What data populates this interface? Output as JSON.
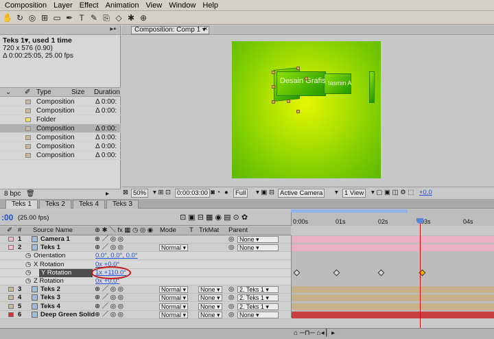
{
  "menubar": [
    "Composition",
    "Layer",
    "Effect",
    "Animation",
    "View",
    "Window",
    "Help"
  ],
  "toolbar": {
    "icons": [
      "hand-tool-icon",
      "rotate-tool-icon",
      "orbit-camera-icon",
      "track-xy-icon",
      "rectangle-mask-icon",
      "pen-tool-icon",
      "type-tool-icon",
      "brush-tool-icon",
      "clone-stamp-icon",
      "eraser-icon",
      "puppet-pin-icon",
      "axis-mode-icon"
    ],
    "glyphs": [
      "✋",
      "↻",
      "◎",
      "⊞",
      "▭",
      "✒",
      "T",
      "✎",
      "⎘",
      "◇",
      "✱",
      "⊕"
    ]
  },
  "project": {
    "item_name": "Teks 1▾, used 1 time",
    "size": "720 x 576 (0.90)",
    "duration": "Δ 0:00:25:05, 25.00 fps",
    "columns": {
      "type": "Type",
      "size": "Size",
      "duration": "Duration"
    },
    "rows": [
      {
        "type": "Composition",
        "duration": "Δ 0:00:",
        "swatch": "#c8b89a",
        "selected": false
      },
      {
        "type": "Composition",
        "duration": "Δ 0:00:",
        "swatch": "#c8b89a",
        "selected": false
      },
      {
        "type": "Folder",
        "duration": "",
        "swatch": "#f0e060",
        "selected": false
      },
      {
        "type": "Composition",
        "duration": "Δ 0:00:",
        "swatch": "#c8b89a",
        "selected": true
      },
      {
        "type": "Composition",
        "duration": "Δ 0:00:",
        "swatch": "#c8b89a",
        "selected": false
      },
      {
        "type": "Composition",
        "duration": "Δ 0:00:",
        "swatch": "#c8b89a",
        "selected": false
      },
      {
        "type": "Composition",
        "duration": "Δ 0:00:",
        "swatch": "#c8b89a",
        "selected": false
      }
    ],
    "bpc": "8 bpc"
  },
  "composition": {
    "tab_label": "Composition: Comp 1",
    "close": "×",
    "text_main": "Desain Grafis",
    "text_mirror": "Iasmin A",
    "zoom": "50%",
    "timecode": "0:00:03:00",
    "resolution": "Full",
    "camera": "Active Camera",
    "views": "1 View",
    "exposure": "+0.0"
  },
  "timeline": {
    "tabs": [
      "Teks 1",
      "Teks 2",
      "Teks 4",
      "Teks 3"
    ],
    "active_tab": 0,
    "current_time": ":00",
    "fps": "(25.00 fps)",
    "ruler_ticks": [
      "0:00s",
      "01s",
      "02s",
      "03s",
      "04s"
    ],
    "columns": {
      "num": "#",
      "source": "Source Name",
      "mode": "Mode",
      "t": "T",
      "trkmat": "TrkMat",
      "parent": "Parent"
    },
    "layers": [
      {
        "num": "1",
        "name": "Camera 1",
        "color": "#f2b8c8",
        "mode": "",
        "trkmat": "",
        "parent": "None"
      },
      {
        "num": "2",
        "name": "Teks 1",
        "color": "#f2b8c8",
        "mode": "Normal",
        "trkmat": "",
        "parent": "None"
      }
    ],
    "properties": [
      {
        "name": "Orientation",
        "value": "0.0°, 0.0°, 0.0°"
      },
      {
        "name": "X Rotation",
        "value": "0x +0.0°"
      },
      {
        "name": "Y Rotation",
        "value": "1x +110.0°"
      },
      {
        "name": "Z Rotation",
        "value": "0x +0.0°"
      }
    ],
    "layers_after": [
      {
        "num": "3",
        "name": "Teks 2",
        "color": "#c8b89a",
        "mode": "Normal",
        "trkmat": "None",
        "parent": "2. Teks 1"
      },
      {
        "num": "4",
        "name": "Teks 3",
        "color": "#c8b89a",
        "mode": "Normal",
        "trkmat": "None",
        "parent": "2. Teks 1"
      },
      {
        "num": "5",
        "name": "Teks 4",
        "color": "#c8b89a",
        "mode": "Normal",
        "trkmat": "None",
        "parent": "2. Teks 1"
      },
      {
        "num": "6",
        "name": "Deep Green Solid",
        "color": "#d83030",
        "mode": "Normal",
        "trkmat": "None",
        "parent": "None"
      }
    ],
    "bar_colors": {
      "pink": "#e8b0c0",
      "tan": "#c8b08a",
      "red": "#c84040"
    }
  }
}
